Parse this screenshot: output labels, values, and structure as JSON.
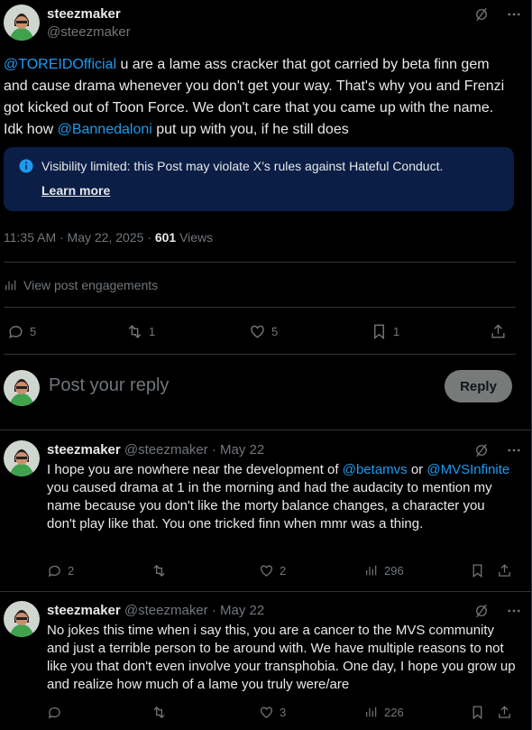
{
  "post": {
    "display_name": "steezmaker",
    "handle": "@steezmaker",
    "text_parts": [
      {
        "t": "@TOREIDOfficial",
        "link": true
      },
      {
        "t": " u are a lame ass cracker that got carried by beta finn gem and cause drama whenever you don't get your way. That's why you and Frenzi got kicked out of Toon Force. We don't care that you came up with the name. Idk how ",
        "link": false
      },
      {
        "t": "@Bannedaloni",
        "link": true
      },
      {
        "t": " put up with you, if he still does",
        "link": false
      }
    ],
    "notice_text": "Visibility limited: this Post may violate X’s rules against Hateful Conduct.",
    "notice_link": "Learn more",
    "time": "11:35 AM · May 22, 2025 · ",
    "views_count": "601",
    "views_label": " Views",
    "engagements_label": "View post engagements",
    "actions": {
      "replies": "5",
      "reposts": "1",
      "likes": "5",
      "bookmarks": "1"
    }
  },
  "composer": {
    "placeholder": "Post your reply",
    "reply_button": "Reply"
  },
  "replies": [
    {
      "display_name": "steezmaker",
      "meta": "@steezmaker · May 22",
      "text_parts": [
        {
          "t": "I hope you are nowhere near the development of ",
          "link": false
        },
        {
          "t": "@betamvs",
          "link": true
        },
        {
          "t": " or ",
          "link": false
        },
        {
          "t": "@MVSInfinite",
          "link": true
        },
        {
          "t": " you caused drama at 1 in the morning and had the audacity to mention my name because you don't like the morty balance changes, a character you don't play like that. You one tricked finn when mmr was a thing.",
          "link": false
        }
      ],
      "actions": {
        "replies": "2",
        "reposts": "",
        "likes": "2",
        "views": "296"
      }
    },
    {
      "display_name": "steezmaker",
      "meta": "@steezmaker · May 22",
      "text_parts": [
        {
          "t": "No jokes this time when i say this, you are a cancer to the MVS community and just a terrible person to be around with. We have multiple reasons to not like you that don't even involve your transphobia. One day, I hope you grow up and realize how much of a lame you truly were/are",
          "link": false
        }
      ],
      "actions": {
        "replies": "",
        "reposts": "",
        "likes": "3",
        "views": "226"
      }
    }
  ]
}
